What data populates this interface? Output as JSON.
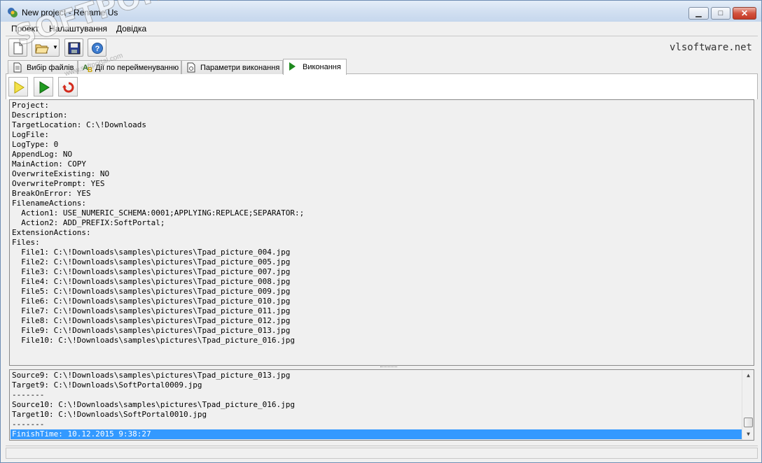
{
  "window": {
    "title": "New project - Rename Us"
  },
  "menu": [
    "Проект",
    "Налаштування",
    "Довідка"
  ],
  "toolbar": {
    "brand": "vlsoftware.net",
    "buttons": [
      "new-file-icon",
      "open-folder-icon",
      "save-icon",
      "help-icon"
    ]
  },
  "tabs": [
    {
      "label": "Вибір файлів",
      "icon": "files-icon",
      "active": false
    },
    {
      "label": "Дії по перейменуванню",
      "icon": "rename-actions-icon",
      "active": false
    },
    {
      "label": "Параметри виконання",
      "icon": "parameters-icon",
      "active": false
    },
    {
      "label": "Виконання",
      "icon": "play-icon",
      "active": true
    }
  ],
  "actions": [
    "preview-play-icon",
    "execute-play-icon",
    "undo-icon"
  ],
  "project_lines": [
    "Project:",
    "Description:",
    "TargetLocation: C:\\!Downloads",
    "LogFile:",
    "LogType: 0",
    "AppendLog: NO",
    "MainAction: COPY",
    "OverwriteExisting: NO",
    "OverwritePrompt: YES",
    "BreakOnError: YES",
    "FilenameActions:",
    "  Action1: USE_NUMERIC_SCHEMA:0001;APPLYING:REPLACE;SEPARATOR:;",
    "  Action2: ADD_PREFIX:SoftPortal;",
    "ExtensionActions:",
    "Files:",
    "  File1: C:\\!Downloads\\samples\\pictures\\Tpad_picture_004.jpg",
    "  File2: C:\\!Downloads\\samples\\pictures\\Tpad_picture_005.jpg",
    "  File3: C:\\!Downloads\\samples\\pictures\\Tpad_picture_007.jpg",
    "  File4: C:\\!Downloads\\samples\\pictures\\Tpad_picture_008.jpg",
    "  File5: C:\\!Downloads\\samples\\pictures\\Tpad_picture_009.jpg",
    "  File6: C:\\!Downloads\\samples\\pictures\\Tpad_picture_010.jpg",
    "  File7: C:\\!Downloads\\samples\\pictures\\Tpad_picture_011.jpg",
    "  File8: C:\\!Downloads\\samples\\pictures\\Tpad_picture_012.jpg",
    "  File9: C:\\!Downloads\\samples\\pictures\\Tpad_picture_013.jpg",
    "  File10: C:\\!Downloads\\samples\\pictures\\Tpad_picture_016.jpg"
  ],
  "log_lines": [
    "Source9: C:\\!Downloads\\samples\\pictures\\Tpad_picture_013.jpg",
    "Target9: C:\\!Downloads\\SoftPortal0009.jpg",
    "-------",
    "Source10: C:\\!Downloads\\samples\\pictures\\Tpad_picture_016.jpg",
    "Target10: C:\\!Downloads\\SoftPortal0010.jpg",
    "-------"
  ],
  "log_selected": "FinishTime: 10.12.2015 9:38:27",
  "watermark": {
    "text": "SOFTPORTAL",
    "sub": "www.softportal.com"
  }
}
